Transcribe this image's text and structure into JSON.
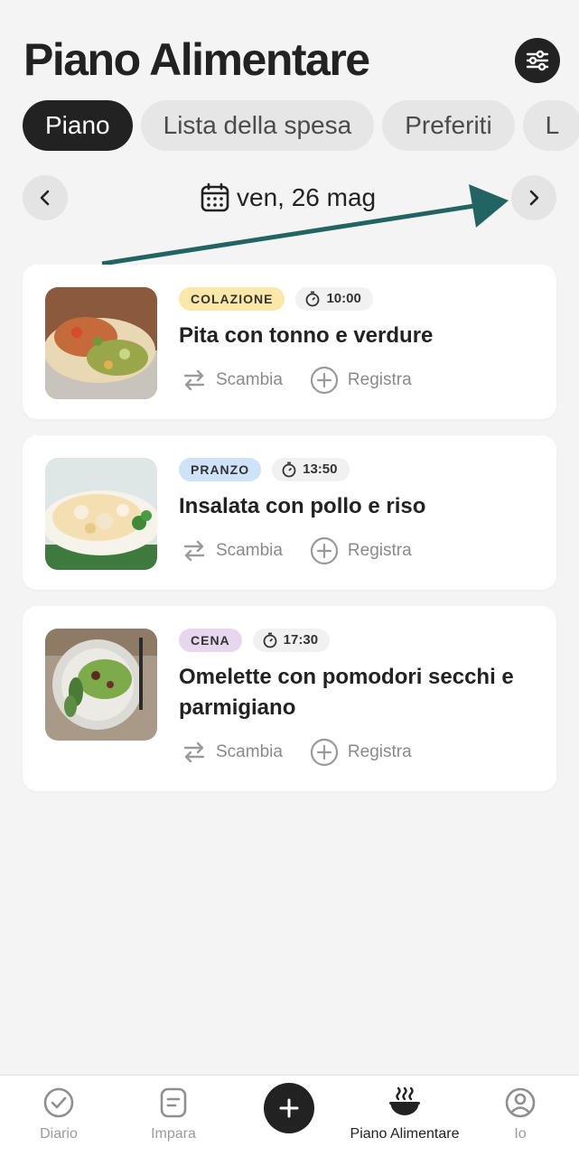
{
  "header": {
    "title": "Piano Alimentare",
    "filter_icon": "sliders-icon"
  },
  "tabs": [
    {
      "label": "Piano",
      "active": true
    },
    {
      "label": "Lista della spesa",
      "active": false
    },
    {
      "label": "Preferiti",
      "active": false
    },
    {
      "label": "L",
      "active": false
    }
  ],
  "date_nav": {
    "date_label": "ven, 26 mag",
    "prev_icon": "chevron-left-icon",
    "next_icon": "chevron-right-icon"
  },
  "meals": [
    {
      "badge": "COLAZIONE",
      "badge_color": "#fbe7a7",
      "time": "10:00",
      "title": "Pita con tonno e verdure",
      "swap_label": "Scambia",
      "log_label": "Registra"
    },
    {
      "badge": "PRANZO",
      "badge_color": "#cfe3f8",
      "time": "13:50",
      "title": "Insalata con pollo e riso",
      "swap_label": "Scambia",
      "log_label": "Registra"
    },
    {
      "badge": "CENA",
      "badge_color": "#e6d7ee",
      "time": "17:30",
      "title": "Omelette con pomodori secchi e parmigiano",
      "swap_label": "Scambia",
      "log_label": "Registra"
    }
  ],
  "bottom_nav": {
    "items": [
      {
        "label": "Diario",
        "icon": "check-circle-icon",
        "active": false
      },
      {
        "label": "Impara",
        "icon": "document-icon",
        "active": false
      },
      {
        "label": "Piano Alimentare",
        "icon": "bowl-icon",
        "active": true
      },
      {
        "label": "Io",
        "icon": "user-circle-icon",
        "active": false
      }
    ],
    "fab_icon": "plus-icon"
  },
  "colors": {
    "dark": "#222222",
    "annotation_arrow": "#226461",
    "background": "#f4f4f4"
  }
}
